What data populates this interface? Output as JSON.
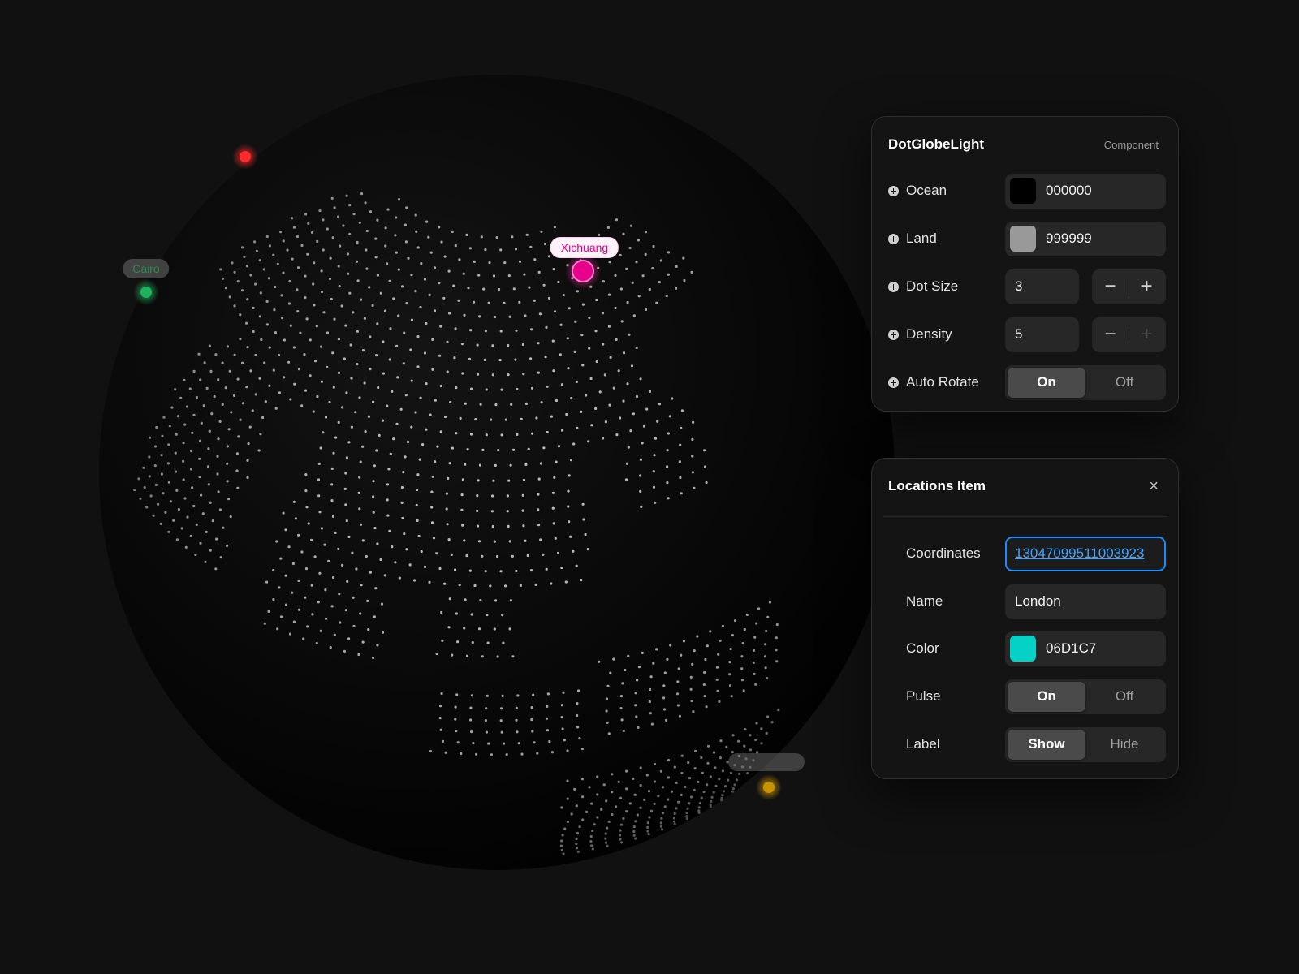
{
  "globe": {
    "markers": [
      {
        "name": "xichuang-marker",
        "label": "Xichuang",
        "color": "#e6008a",
        "label_style": "label-xichuang",
        "show_label": true
      },
      {
        "name": "cairo-marker",
        "label": "Cairo",
        "color": "#1fb25c",
        "label_style": "label-cairo",
        "show_label": true
      },
      {
        "name": "red-marker",
        "label": "",
        "color": "#ff2a2a",
        "label_style": "",
        "show_label": false
      },
      {
        "name": "yellow-marker",
        "label": "",
        "color": "#c79300",
        "label_style": "label-faded",
        "show_label": true
      }
    ]
  },
  "component_panel": {
    "title": "DotGlobeLight",
    "tag": "Component",
    "ocean": {
      "label": "Ocean",
      "value": "000000",
      "color": "#000000"
    },
    "land": {
      "label": "Land",
      "value": "999999",
      "color": "#999999"
    },
    "dot_size": {
      "label": "Dot Size",
      "value": "3",
      "minus": "−",
      "plus": "+"
    },
    "density": {
      "label": "Density",
      "value": "5",
      "minus": "−",
      "plus": "+"
    },
    "auto_rotate": {
      "label": "Auto Rotate",
      "on": "On",
      "off": "Off",
      "selected": "On"
    }
  },
  "location_panel": {
    "title": "Locations Item",
    "close": "×",
    "coordinates": {
      "label": "Coordinates",
      "value": "13047099511003923"
    },
    "name": {
      "label": "Name",
      "value": "London"
    },
    "color": {
      "label": "Color",
      "value": "06D1C7",
      "color": "#06D1C7"
    },
    "pulse": {
      "label": "Pulse",
      "on": "On",
      "off": "Off",
      "selected": "On"
    },
    "label": {
      "label": "Label",
      "show": "Show",
      "hide": "Hide",
      "selected": "Show"
    }
  }
}
